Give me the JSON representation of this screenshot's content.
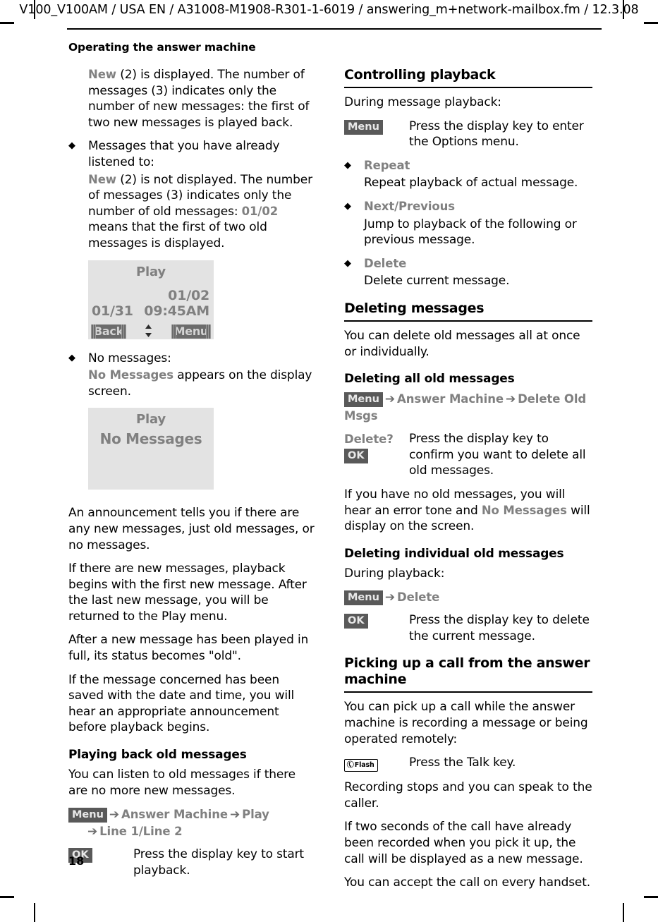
{
  "running_header": "V100_V100AM / USA EN / A31008-M1908-R301-1-6019 / answering_m+network-mailbox.fm / 12.3.08",
  "chapter_title": "Operating the answer machine",
  "page_number": "18",
  "colors": {
    "softkey_background": "#595959",
    "softkey_text": "#e8e8e8",
    "menu_item_text": "#808080",
    "screen_background": "#e3e3e3",
    "screen_text": "#808080",
    "screen_softkey_background": "#6b6b6b"
  },
  "left_column": {
    "para_new_displayed": {
      "lead": "New",
      "rest": " (2) is displayed. The number of messages (3) indicates only the number of new messages: the first of two new messages is played back."
    },
    "bullet_listened": {
      "glyph": "◆",
      "text": "Messages that you have already listened to:"
    },
    "para_new_not_displayed": {
      "lead": "New",
      "mid": " (2) is not displayed. The number of messages (3) indicates only the number of old messages: ",
      "code": "01/02",
      "tail": " means that the first of two old messages is displayed."
    },
    "screen_play": {
      "title": "Play",
      "counter": "01/02",
      "date": "01/31",
      "time": "09:45AM",
      "softkey_left": "Back",
      "softkey_right": "Menu",
      "updown_icon": "⬍"
    },
    "bullet_no_messages": {
      "glyph": "◆",
      "text": "No messages:"
    },
    "para_no_messages": {
      "lead": "No Messages",
      "rest": " appears on the display screen."
    },
    "screen_no_messages": {
      "title": "Play",
      "body": "No Messages"
    },
    "para_announcement": "An announcement tells you if there are any new messages, just old messages, or no messages.",
    "para_new_playback": "If there are new messages, playback begins with the first new message. After the last new message, you will be returned to the Play menu.",
    "para_status_old": "After a new message has been played in full, its status becomes \"old\".",
    "para_saved_datetime": "If the message concerned has been saved with the date and time, you will hear an appropriate announcement before playback begins.",
    "heading_playing_old": "Playing back old messages",
    "para_listen_old": "You can listen to old messages if there are no more new messages.",
    "menupath_play": {
      "softkey": "Menu",
      "arrow": "➔",
      "item1": "Answer Machine",
      "item2": "Play",
      "item3": "Line 1/Line 2"
    },
    "row_ok_play": {
      "key": "OK",
      "desc": "Press the display key to start playback."
    }
  },
  "right_column": {
    "heading_controlling": "Controlling playback",
    "para_during_playback": "During message playback:",
    "row_menu_options": {
      "key": "Menu",
      "desc": "Press the display key to enter the Options menu."
    },
    "options": [
      {
        "glyph": "◆",
        "label": "Repeat",
        "desc": "Repeat playback of actual message."
      },
      {
        "glyph": "◆",
        "label": "Next/Previous",
        "desc": "Jump to playback of the following or previous message."
      },
      {
        "glyph": "◆",
        "label": "Delete",
        "desc": "Delete current message."
      }
    ],
    "heading_deleting": "Deleting messages",
    "para_delete_intro": "You can delete old messages all at once or individually.",
    "heading_delete_all": "Deleting all old messages",
    "menupath_delete_old": {
      "softkey": "Menu",
      "arrow": "➔",
      "item1": "Answer Machine",
      "item2": "Delete Old Msgs"
    },
    "row_delete_confirm": {
      "prompt": "Delete?",
      "key": "OK",
      "desc": "Press the display key to confirm you want to delete all old messages."
    },
    "para_no_old_messages": {
      "lead": "If you have no old messages, you will hear an error tone and ",
      "code": "No Messages",
      "tail": " will display on the screen."
    },
    "heading_delete_individual": "Deleting individual old messages",
    "para_during_playback_2": "During playback:",
    "menupath_delete": {
      "softkey": "Menu",
      "arrow": "➔",
      "item1": "Delete"
    },
    "row_ok_delete": {
      "key": "OK",
      "desc": "Press the display key to delete the current message."
    },
    "heading_picking_up": "Picking up a call from the answer machine",
    "para_pick_up_intro": "You can pick up a call while the answer machine is recording a message or being operated remotely:",
    "row_talk_key": {
      "key_icon": "✆",
      "key_label": "Flash",
      "desc": "Press the Talk key."
    },
    "para_recording_stops": "Recording stops and you can speak to the caller.",
    "para_two_seconds": "If two seconds of the call have already been recorded when you pick it up, the call will be displayed as a new message.",
    "para_accept_call": "You can accept the call on every handset."
  }
}
